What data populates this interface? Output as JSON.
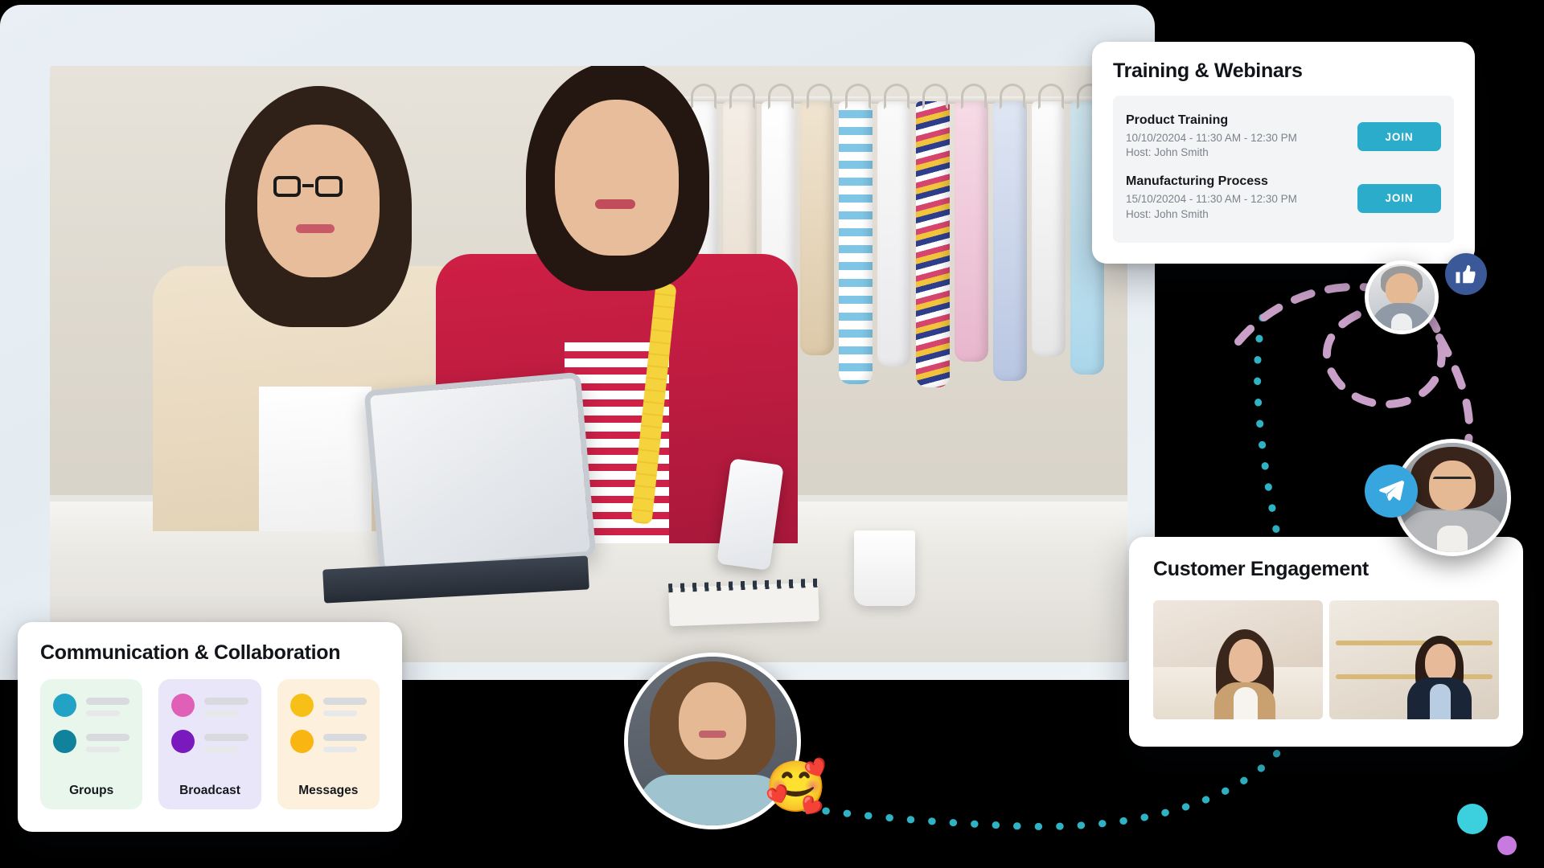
{
  "theme": {
    "background": "#000000",
    "panel_background": "#E6EDF2",
    "card_background": "#FFFFFF",
    "accent_join": "#2BACCA",
    "badge_like": "#3B5998",
    "badge_send": "#37A6DE",
    "deco_cyan": "#3CCFDD",
    "deco_purple": "#C77BE0",
    "dotted_path_teal": "#2FB3C4",
    "dashed_path_pink": "#C9A0C8"
  },
  "training_card": {
    "title": "Training & Webinars",
    "sessions": [
      {
        "name": "Product Training",
        "when": "10/10/20204 - 11:30 AM - 12:30 PM",
        "host": "Host: John Smith",
        "action_label": "JOIN"
      },
      {
        "name": "Manufacturing Process",
        "when": "15/10/20204 - 11:30 AM - 12:30 PM",
        "host": "Host: John Smith",
        "action_label": "JOIN"
      }
    ]
  },
  "communication_card": {
    "title": "Communication & Collaboration",
    "tiles": [
      {
        "label": "Groups",
        "background": "#E8F6EC",
        "avatar_colors": [
          "#22A2C4",
          "#10829B"
        ]
      },
      {
        "label": "Broadcast",
        "background": "#E9E6F9",
        "avatar_colors": [
          "#E060B8",
          "#7A19BE"
        ]
      },
      {
        "label": "Messages",
        "background": "#FDF0DC",
        "avatar_colors": [
          "#F6C016",
          "#F9B512"
        ]
      }
    ]
  },
  "engagement_card": {
    "title": "Customer Engagement",
    "video_tiles": [
      {
        "caption": "customer-video-tile"
      },
      {
        "caption": "agent-video-tile"
      }
    ]
  },
  "avatars": [
    {
      "name": "reviewer-avatar",
      "badge": "thumbs-up-icon"
    },
    {
      "name": "support-agent-avatar",
      "badge": "send-icon"
    },
    {
      "name": "customer-avatar",
      "badge": "smiling-face-with-hearts-emoji"
    }
  ],
  "badges": {
    "like_icon": "👍",
    "send_icon": "➤",
    "love_emoji": "🥰"
  },
  "hero_photo": {
    "alt": "Two retail colleagues reviewing a tablet beside a clothing rack"
  }
}
